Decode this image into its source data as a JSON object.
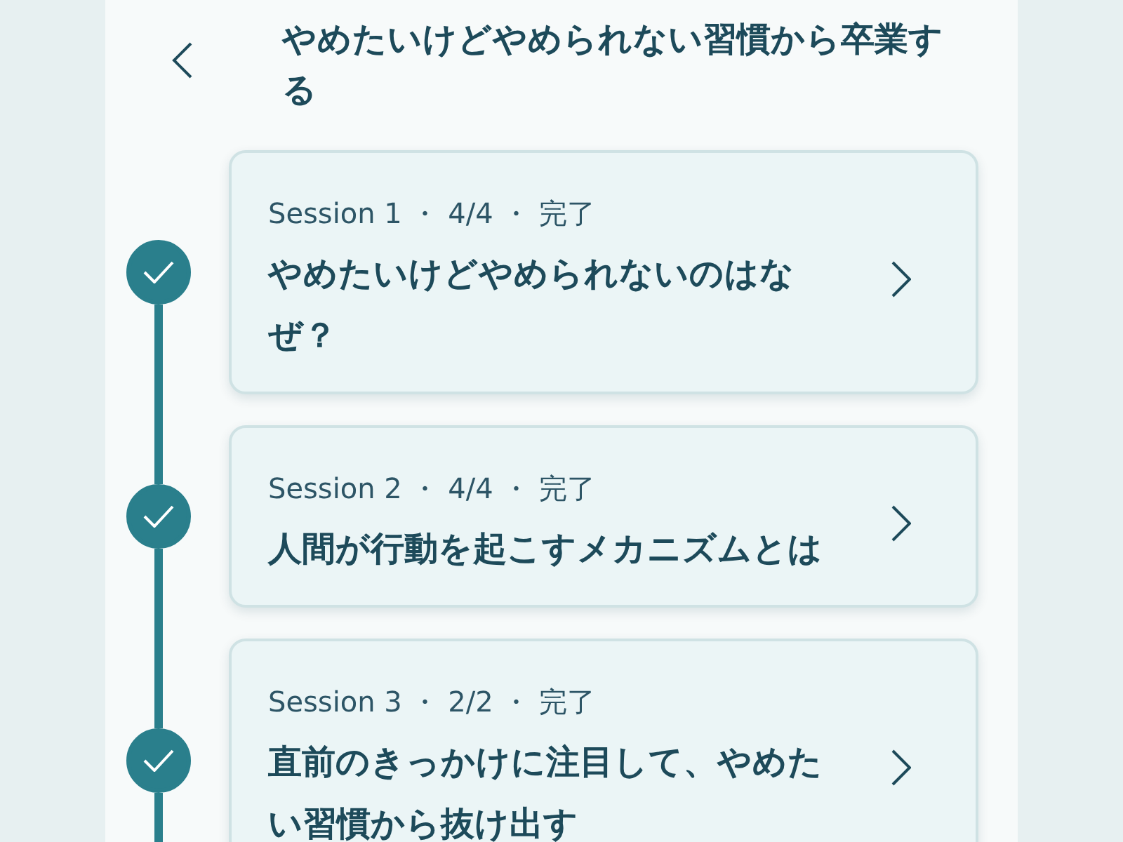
{
  "header": {
    "title": "やめたいけどやめられない習慣から卒業する"
  },
  "sessions": [
    {
      "meta": "Session 1 ・ 4/4 ・ 完了",
      "title": "やめたいけどやめられないのはなぜ？",
      "completed": true
    },
    {
      "meta": "Session 2 ・ 4/4 ・ 完了",
      "title": "人間が行動を起こすメカニズムとは",
      "completed": true
    },
    {
      "meta": "Session 3 ・ 2/2 ・ 完了",
      "title": "直前のきっかけに注目して、やめたい習慣から抜け出す",
      "completed": true
    }
  ]
}
